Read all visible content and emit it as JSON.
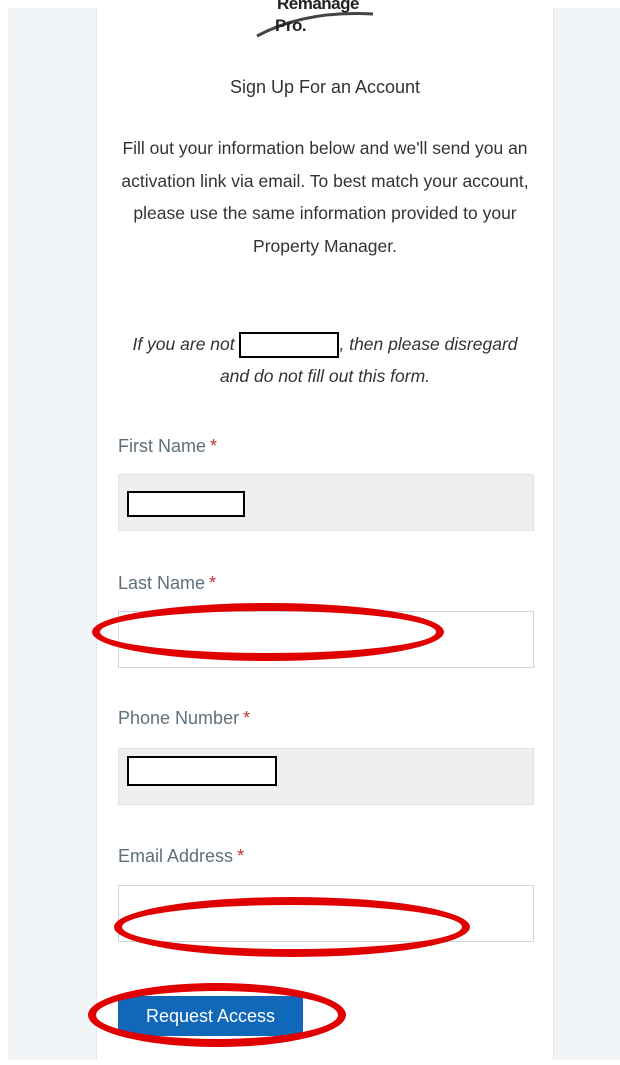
{
  "logo": {
    "line1": "Remanage",
    "line2": "Pro."
  },
  "page_title": "Sign Up For an Account",
  "intro_text": "Fill out your information below and we'll send you an activation link via email. To best match your account, please use the same information provided to your Property Manager.",
  "notice": {
    "before": "If you are not ",
    "after": ", then please disregard and do not fill out this form."
  },
  "form": {
    "first_name": {
      "label": "First Name",
      "required_mark": "*",
      "value": ""
    },
    "last_name": {
      "label": "Last Name",
      "required_mark": "*",
      "value": ""
    },
    "phone": {
      "label": "Phone Number",
      "required_mark": "*",
      "value": ""
    },
    "email": {
      "label": "Email Address",
      "required_mark": "*",
      "value": ""
    }
  },
  "submit_label": "Request Access",
  "colors": {
    "accent": "#1168b8",
    "annotation": "#e00000",
    "required": "#c53030"
  }
}
